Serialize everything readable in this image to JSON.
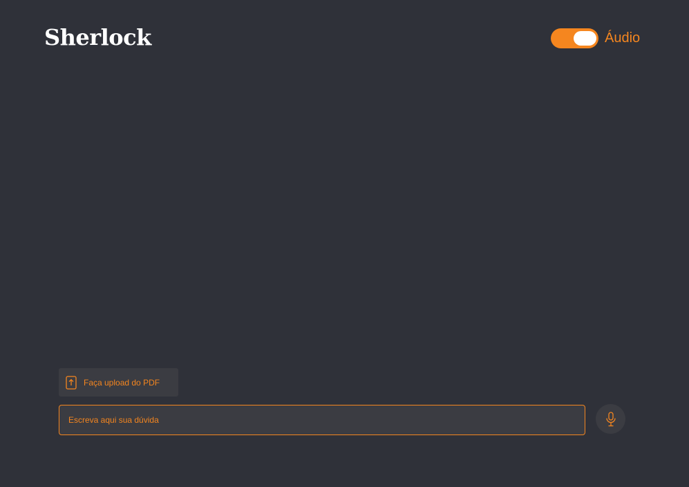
{
  "header": {
    "title": "Sherlock",
    "audio_toggle": {
      "label": "Áudio",
      "enabled": true
    }
  },
  "composer": {
    "upload_label": "Faça upload do PDF",
    "input_placeholder": "Escreva aqui sua dúvida",
    "input_value": ""
  },
  "icons": {
    "upload": "upload-file-icon",
    "mic": "microphone-icon"
  },
  "colors": {
    "background": "#2f3139",
    "surface": "#3b3c42",
    "accent": "#f5861f",
    "title": "#ffffff"
  }
}
